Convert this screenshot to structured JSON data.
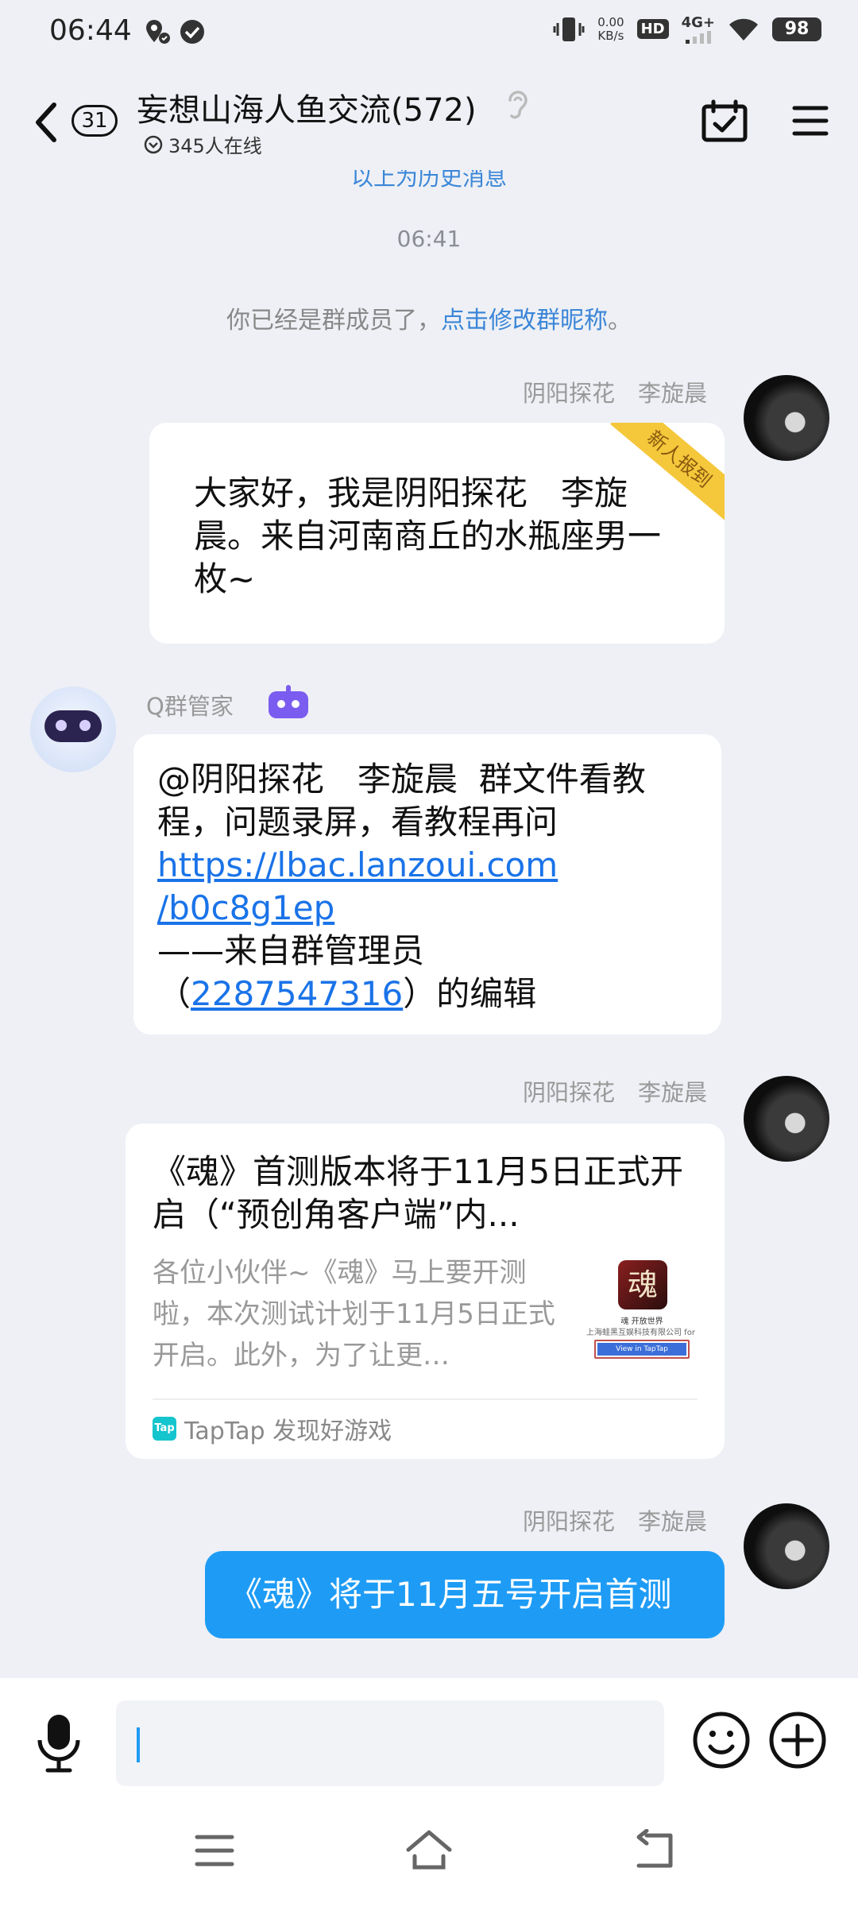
{
  "status_bar": {
    "time": "06:44",
    "net_speed_value": "0.00",
    "net_speed_unit": "KB/s",
    "hd_label": "HD",
    "network_type": "4G+",
    "battery": "98"
  },
  "header": {
    "back_count": "31",
    "title": "妄想山海人鱼交流(572)",
    "online": "345人在线"
  },
  "chat": {
    "history_link": "以上为历史消息",
    "timestamp": "06:41",
    "system_notice_prefix": "你已经是群成员了，",
    "system_notice_link": "点击修改群昵称",
    "system_notice_suffix": "。",
    "messages": [
      {
        "sender": "阴阳探花　李旋晨",
        "badge": "新人报到",
        "text": "大家好，我是阴阳探花　李旋晨。来自河南商丘的水瓶座男一枚~"
      },
      {
        "sender": "Q群管家",
        "mention": "@阴阳探花　李旋晨",
        "text_after_mention": "群文件看教程，问题录屏，看教程再问",
        "url_line1": "https://lbac.lanzoui.com",
        "url_line2": "/b0c8g1ep",
        "signature_line": "——来自群管理员",
        "editor_prefix": "（",
        "editor_qq": "2287547316",
        "editor_suffix": "）的编辑"
      },
      {
        "sender": "阴阳探花　李旋晨",
        "card_title": "《魂》首测版本将于11月5日正式开启（“预创角客户端”内...",
        "card_desc": "各位小伙伴~《魂》马上要开测啦，本次测试计划于11月5日正式开启。此外，为了让更…",
        "card_thumb_title": "魂",
        "card_thumb_sub": "魂 开放世界",
        "card_thumb_company": "上海蛙黑互娱科技有限公司 for ii",
        "card_thumb_button": "View in TapTap",
        "card_source_logo": "Tap",
        "card_source": "TapTap 发现好游戏"
      },
      {
        "sender": "阴阳探花　李旋晨",
        "text": "《魂》将于11月五号开启首测"
      }
    ]
  },
  "input": {
    "placeholder": ""
  },
  "colors": {
    "background": "#eef0f5",
    "accent_blue": "#1e9cf5",
    "link_blue": "#3b86d8",
    "badge_yellow": "#f5c73b",
    "robot_purple": "#7b5cf0"
  },
  "icons": [
    "location-check-icon",
    "check-circle-icon",
    "vibrate-icon",
    "signal-icon",
    "wifi-icon",
    "back-arrow-icon",
    "ear-icon",
    "calendar-check-icon",
    "menu-icon",
    "robot-icon",
    "mic-icon",
    "emoji-icon",
    "plus-icon",
    "nav-menu-icon",
    "nav-home-icon",
    "nav-back-icon"
  ]
}
